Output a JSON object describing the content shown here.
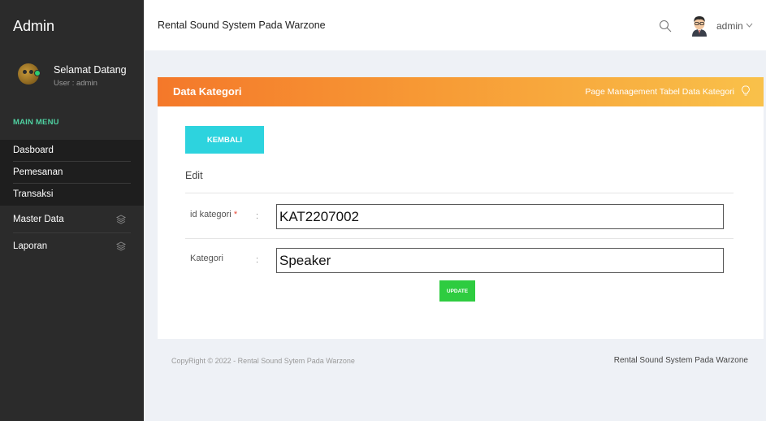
{
  "sidebar": {
    "brand": "Admin",
    "welcome": "Selamat Datang",
    "user_line": "User : admin",
    "menu_title": "MAIN MENU",
    "items": [
      {
        "label": "Dasboard"
      },
      {
        "label": "Pemesanan"
      },
      {
        "label": "Transaksi"
      }
    ],
    "groups": [
      {
        "label": "Master Data",
        "icon": "layers-icon"
      },
      {
        "label": "Laporan",
        "icon": "layers-icon"
      }
    ]
  },
  "header": {
    "title": "Rental Sound System Pada Warzone",
    "user": "admin"
  },
  "card": {
    "title": "Data Kategori",
    "subtitle": "Page Management Tabel Data Kategori",
    "back_label": "KEMBALI",
    "section_label": "Edit",
    "fields": [
      {
        "label": "id kategori",
        "required": "*",
        "colon": ":",
        "value": "KAT2207002"
      },
      {
        "label": "Kategori",
        "colon": ":",
        "value": "Speaker"
      }
    ],
    "update_label": "UPDATE"
  },
  "footer": {
    "copyright": "CopyRight © 2022 - Rental Sound Sytem Pada Warzone",
    "right": "Rental Sound System Pada Warzone"
  },
  "colors": {
    "sidebar_bg": "#2b2b2b",
    "menu_title": "#4fd1a1",
    "header_gradient_start": "#f4782a",
    "header_gradient_end": "#f9c14a",
    "back_button": "#2dd3de",
    "update_button": "#2ecc40"
  }
}
